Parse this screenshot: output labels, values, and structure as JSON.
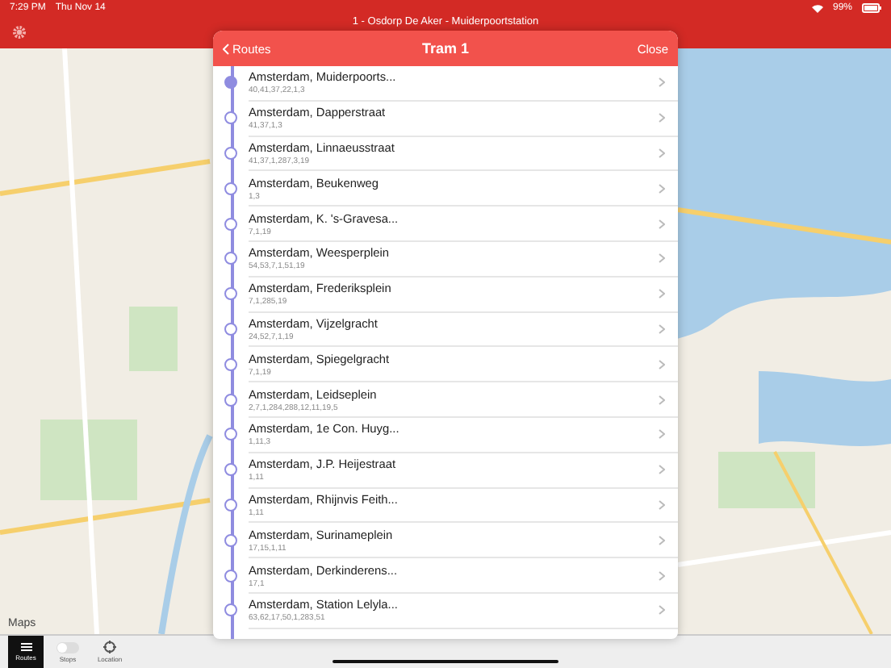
{
  "status_bar": {
    "time": "7:29 PM",
    "date": "Thu Nov 14",
    "battery": "99%"
  },
  "nav_bar": {
    "title": "1 - Osdorp De Aker - Muiderpoortstation"
  },
  "map": {
    "kind": "picture",
    "attribution": "Maps"
  },
  "modal": {
    "back": "Routes",
    "title": "Tram 1",
    "close": "Close",
    "stops": [
      {
        "name": "Amsterdam, Muiderpoorts...",
        "lines": "40,41,37,22,1,3",
        "selected": true
      },
      {
        "name": "Amsterdam, Dapperstraat",
        "lines": "41,37,1,3",
        "selected": false
      },
      {
        "name": "Amsterdam, Linnaeusstraat",
        "lines": "41,37,1,287,3,19",
        "selected": false
      },
      {
        "name": "Amsterdam, Beukenweg",
        "lines": "1,3",
        "selected": false
      },
      {
        "name": "Amsterdam, K. 's-Gravesa...",
        "lines": "7,1,19",
        "selected": false
      },
      {
        "name": "Amsterdam, Weesperplein",
        "lines": "54,53,7,1,51,19",
        "selected": false
      },
      {
        "name": "Amsterdam, Frederiksplein",
        "lines": "7,1,285,19",
        "selected": false
      },
      {
        "name": "Amsterdam, Vijzelgracht",
        "lines": "24,52,7,1,19",
        "selected": false
      },
      {
        "name": "Amsterdam, Spiegelgracht",
        "lines": "7,1,19",
        "selected": false
      },
      {
        "name": "Amsterdam, Leidseplein",
        "lines": "2,7,1,284,288,12,11,19,5",
        "selected": false
      },
      {
        "name": "Amsterdam, 1e Con. Huyg...",
        "lines": "1,11,3",
        "selected": false
      },
      {
        "name": "Amsterdam, J.P. Heijestraat",
        "lines": "1,11",
        "selected": false
      },
      {
        "name": "Amsterdam, Rhijnvis Feith...",
        "lines": "1,11",
        "selected": false
      },
      {
        "name": "Amsterdam, Surinameplein",
        "lines": "17,15,1,11",
        "selected": false
      },
      {
        "name": "Amsterdam, Derkinderens...",
        "lines": "17,1",
        "selected": false
      },
      {
        "name": "Amsterdam, Station Lelyla...",
        "lines": "63,62,17,50,1,283,51",
        "selected": false
      }
    ]
  },
  "tab_bar": [
    {
      "label": "Routes",
      "kind": "list",
      "selected": true
    },
    {
      "label": "Stops",
      "kind": "toggle",
      "selected": false
    },
    {
      "label": "Location",
      "kind": "location",
      "selected": false
    }
  ]
}
